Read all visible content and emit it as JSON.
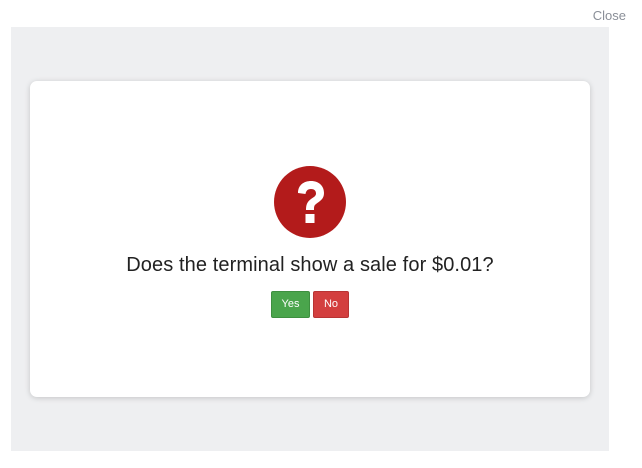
{
  "header": {
    "close_label": "Close"
  },
  "dialog": {
    "icon": "question-circle-icon",
    "icon_color": "#b31b1b",
    "prompt": "Does the terminal show a sale for $0.01?",
    "buttons": {
      "yes_label": "Yes",
      "yes_color": "#4aa54c",
      "no_label": "No",
      "no_color": "#d33f3f"
    }
  }
}
